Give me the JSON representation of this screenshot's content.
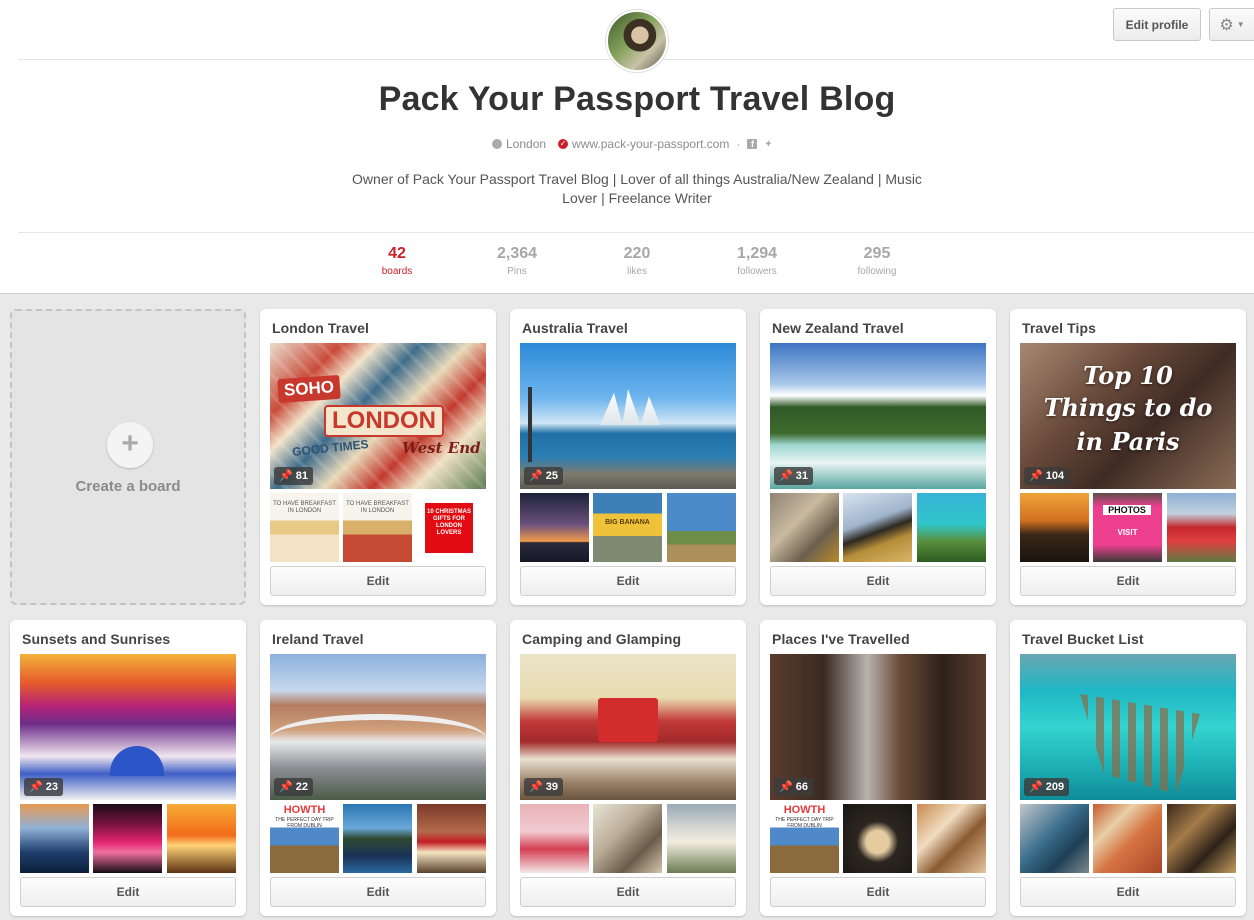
{
  "profile": {
    "name": "Pack Your Passport Travel Blog",
    "location": "London",
    "website": "www.pack-your-passport.com",
    "bio": "Owner of Pack Your Passport Travel Blog | Lover of all things Australia/New Zealand | Music Lover | Freelance Writer"
  },
  "header": {
    "edit_profile_label": "Edit profile",
    "settings_icon": "gear-icon",
    "facebook_icon": "f",
    "twitter_icon": "t"
  },
  "stats": [
    {
      "value": "42",
      "label": "boards"
    },
    {
      "value": "2,364",
      "label": "Pins"
    },
    {
      "value": "220",
      "label": "likes"
    },
    {
      "value": "1,294",
      "label": "followers"
    },
    {
      "value": "295",
      "label": "following"
    }
  ],
  "create_board": {
    "plus": "+",
    "label": "Create a board"
  },
  "boards": [
    {
      "title": "London Travel",
      "pins": "81",
      "edit": "Edit",
      "cover_text": [
        "SOHO",
        "LONDON",
        "GOOD TIMES",
        "West End"
      ],
      "thumb_text": [
        "TO HAVE BREAKFAST IN LONDON",
        "TO HAVE BREAKFAST IN LONDON",
        "10 CHRISTMAS GIFTS FOR LONDON LOVERS"
      ]
    },
    {
      "title": "Australia Travel",
      "pins": "25",
      "edit": "Edit",
      "thumb_text": [
        "",
        "BIG BANANA",
        ""
      ]
    },
    {
      "title": "New Zealand Travel",
      "pins": "31",
      "edit": "Edit"
    },
    {
      "title": "Travel Tips",
      "pins": "104",
      "edit": "Edit",
      "cover_text": [
        "Top 10",
        "Things to do",
        "in Paris"
      ],
      "thumb_text": [
        "",
        "PHOTOS",
        ""
      ],
      "thumb_text_2": "VISIT"
    },
    {
      "title": "Sunsets and Sunrises",
      "pins": "23",
      "edit": "Edit"
    },
    {
      "title": "Ireland Travel",
      "pins": "22",
      "edit": "Edit",
      "thumb_text": [
        "HOWTH",
        "",
        ""
      ],
      "thumb_sub": "THE PERFECT DAY TRIP FROM DUBLIN"
    },
    {
      "title": "Camping and Glamping",
      "pins": "39",
      "edit": "Edit"
    },
    {
      "title": "Places I've Travelled",
      "pins": "66",
      "edit": "Edit",
      "thumb_text": [
        "HOWTH",
        "",
        ""
      ],
      "thumb_sub": "THE PERFECT DAY TRIP FROM DUBLIN"
    },
    {
      "title": "Travel Bucket List",
      "pins": "209",
      "edit": "Edit"
    }
  ],
  "colors": {
    "accent": "#cb2027",
    "page_bg": "#e9e9e9",
    "stat_muted": "#a7a7a7"
  }
}
